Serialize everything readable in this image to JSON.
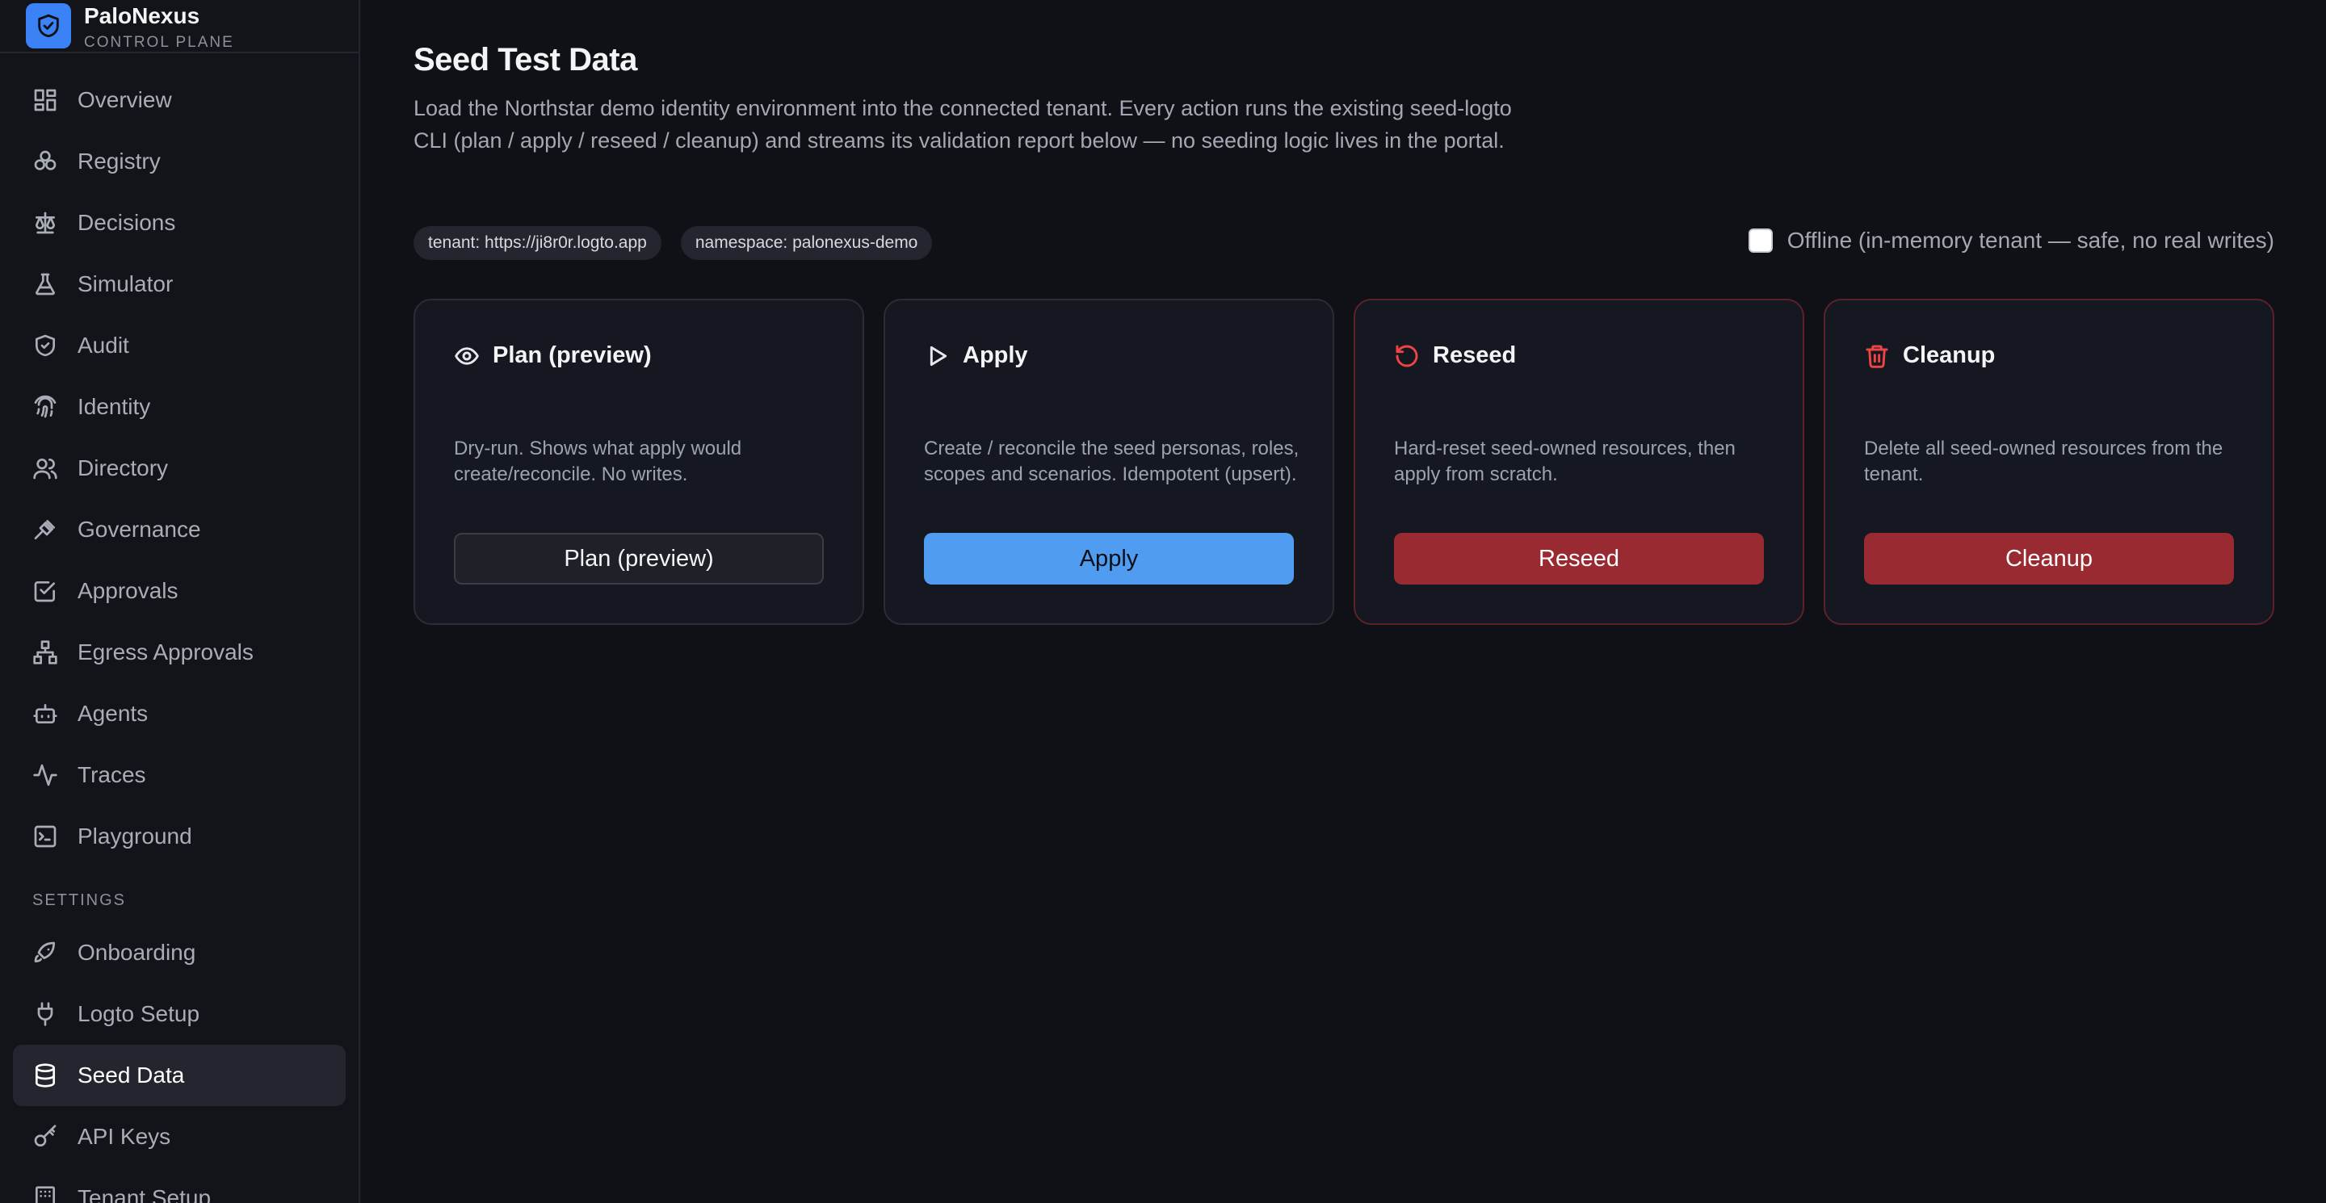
{
  "brand": {
    "name": "PaloNexus",
    "subtitle": "CONTROL PLANE"
  },
  "nav": [
    {
      "label": "Overview",
      "icon": "dashboard-icon"
    },
    {
      "label": "Registry",
      "icon": "boxes-icon"
    },
    {
      "label": "Decisions",
      "icon": "scale-icon"
    },
    {
      "label": "Simulator",
      "icon": "flask-icon"
    },
    {
      "label": "Audit",
      "icon": "shield-check-icon"
    },
    {
      "label": "Identity",
      "icon": "fingerprint-icon"
    },
    {
      "label": "Directory",
      "icon": "users-icon"
    },
    {
      "label": "Governance",
      "icon": "gavel-icon"
    },
    {
      "label": "Approvals",
      "icon": "check-square-icon"
    },
    {
      "label": "Egress Approvals",
      "icon": "network-icon"
    },
    {
      "label": "Agents",
      "icon": "bot-icon"
    },
    {
      "label": "Traces",
      "icon": "activity-icon"
    },
    {
      "label": "Playground",
      "icon": "terminal-icon"
    }
  ],
  "settings_section": "SETTINGS",
  "settings_nav": [
    {
      "label": "Onboarding",
      "icon": "rocket-icon"
    },
    {
      "label": "Logto Setup",
      "icon": "plug-icon"
    },
    {
      "label": "Seed Data",
      "icon": "database-icon",
      "active": true
    },
    {
      "label": "API Keys",
      "icon": "key-icon"
    },
    {
      "label": "Tenant Setup",
      "icon": "building-icon"
    }
  ],
  "page": {
    "title": "Seed Test Data",
    "description": "Load the Northstar demo identity environment into the connected tenant. Every action runs the existing seed-logto CLI (plan / apply / reseed / cleanup) and streams its validation report below — no seeding logic lives in the portal.",
    "chips": [
      "tenant: https://ji8r0r.logto.app",
      "namespace: palonexus-demo"
    ],
    "offline_label": "Offline (in-memory tenant — safe, no real writes)",
    "offline_checked": false
  },
  "cards": [
    {
      "title": "Plan (preview)",
      "icon": "eye-icon",
      "description": "Dry-run. Shows what apply would create/reconcile. No writes.",
      "button": "Plan (preview)",
      "variant": "outline"
    },
    {
      "title": "Apply",
      "icon": "play-icon",
      "description": "Create / reconcile the seed personas, roles, scopes and scenarios. Idempotent (upsert).",
      "button": "Apply",
      "variant": "primary"
    },
    {
      "title": "Reseed",
      "icon": "rotate-ccw-icon",
      "description": "Hard-reset seed-owned resources, then apply from scratch.",
      "button": "Reseed",
      "variant": "danger"
    },
    {
      "title": "Cleanup",
      "icon": "trash-icon",
      "description": "Delete all seed-owned resources from the tenant.",
      "button": "Cleanup",
      "variant": "danger"
    }
  ],
  "colors": {
    "accent": "#4f9cf0",
    "danger": "#9a2a31",
    "danger_icon": "#ef4444",
    "background": "#0f1116"
  }
}
